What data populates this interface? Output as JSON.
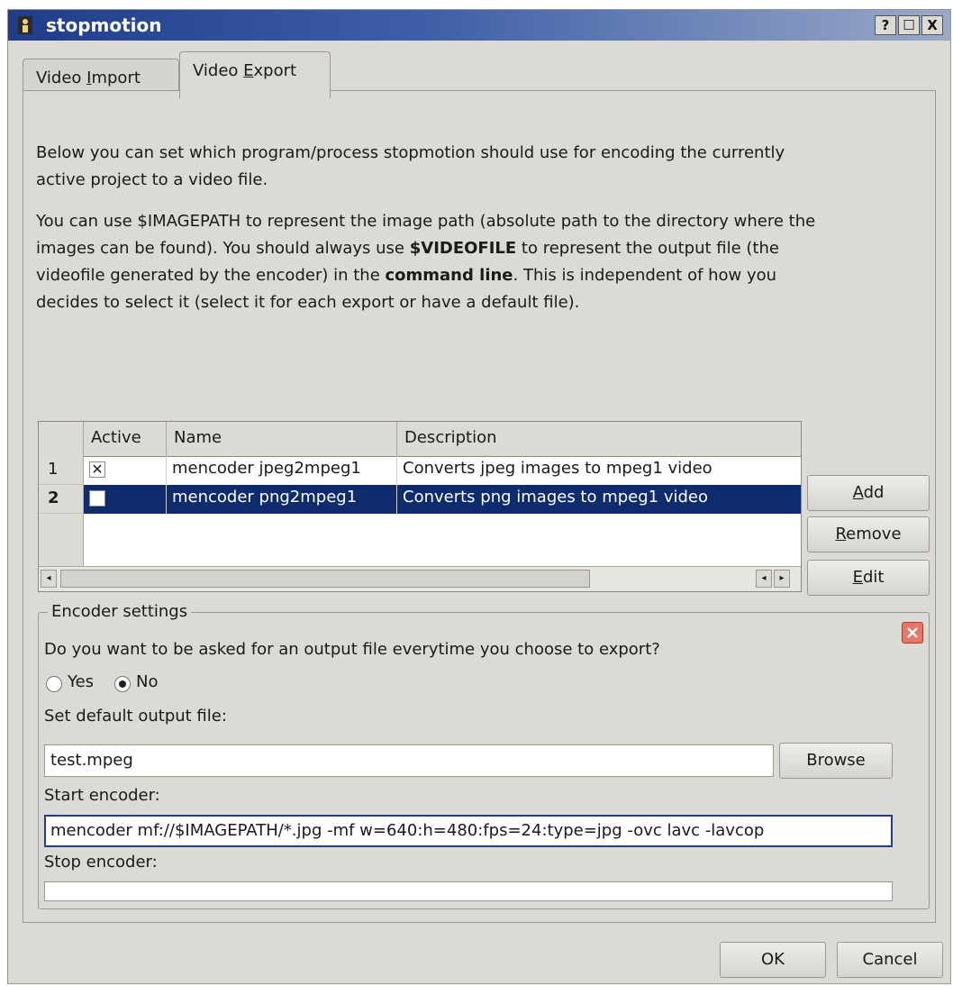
{
  "window": {
    "title": "stopmotion",
    "help_label": "?",
    "maximize_label": "☐",
    "close_label": "X"
  },
  "tabs": [
    {
      "label_pre": "Video ",
      "label_key": "I",
      "label_post": "mport",
      "active": false
    },
    {
      "label_pre": "Video ",
      "label_key": "E",
      "label_post": "xport",
      "active": true
    }
  ],
  "intro": {
    "para1": "Below you can set which program/process stopmotion should use for encoding the currently active project to a video file.",
    "para2_a": "You can use $IMAGEPATH to represent the image path (absolute path to the directory where the images can be found). You should always use ",
    "para2_b": "$VIDEOFILE",
    "para2_c": " to represent the output file (the videofile generated by the encoder) in the ",
    "para2_d": "command line",
    "para2_e": ". This is independent of how you decides to select it (select it for each export or have a default file)."
  },
  "table": {
    "columns": [
      "Active",
      "Name",
      "Description"
    ],
    "rows": [
      {
        "num": "1",
        "active": true,
        "active_mark": "✕",
        "name": "mencoder jpeg2mpeg1",
        "description": "Converts jpeg images to mpeg1 video",
        "selected": false
      },
      {
        "num": "2",
        "active": false,
        "active_mark": "",
        "name": "mencoder png2mpeg1",
        "description": "Converts png images to mpeg1 video",
        "selected": true
      }
    ],
    "scroll_left": "◂",
    "scroll_right": "▸"
  },
  "side_buttons": {
    "add_key": "A",
    "add_rest": "dd",
    "remove_key": "R",
    "remove_rest": "emove",
    "edit_key": "E",
    "edit_rest": "dit"
  },
  "encoder": {
    "group_title": "Encoder settings",
    "ask_question": "Do you want to be asked for an output file everytime you choose to export?",
    "yes_label": "Yes",
    "no_label": "No",
    "selected_option": "No",
    "default_output_label": "Set default output file:",
    "default_output_value": "test.mpeg",
    "browse_label": "Browse",
    "start_label": "Start encoder:",
    "start_value": "mencoder mf://$IMAGEPATH/*.jpg -mf w=640:h=480:fps=24:type=jpg -ovc lavc -lavcop",
    "stop_label": "Stop encoder:",
    "stop_value": ""
  },
  "dialog": {
    "ok_label": "OK",
    "cancel_label": "Cancel"
  },
  "colors": {
    "titlebar": "#1f3d8a",
    "selection": "#0e2b6e",
    "window_bg": "#dcdad5"
  }
}
